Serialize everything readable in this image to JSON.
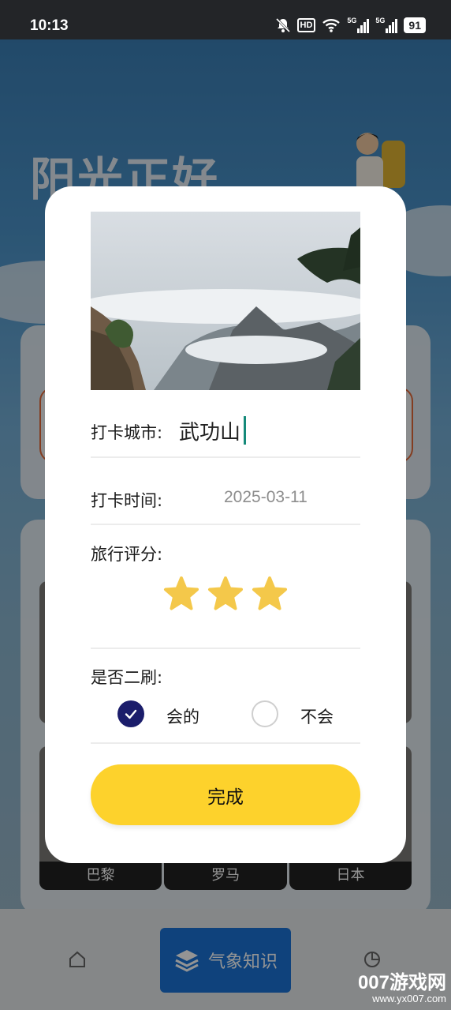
{
  "status_bar": {
    "time": "10:13",
    "hd": "HD",
    "net1": "5G",
    "net2": "5G",
    "battery": "91"
  },
  "background": {
    "hero_title": "阳光正好",
    "cards": [
      "巴黎",
      "罗马",
      "日本"
    ],
    "nav_center_label": "气象知识"
  },
  "dialog": {
    "city_label": "打卡城市:",
    "city_value": "武功山",
    "time_label": "打卡时间:",
    "time_value": "2025-03-11",
    "rating_label": "旅行评分:",
    "rating_stars": 3,
    "revisit_label": "是否二刷:",
    "option_yes": "会的",
    "option_no": "不会",
    "selected": "yes",
    "done_button": "完成"
  },
  "watermark": {
    "big": "007游戏网",
    "small": "www.yx007.com"
  },
  "colors": {
    "accent_button": "#fdd22c",
    "radio_selected": "#1b1d6b",
    "caret": "#158a7a",
    "nav_center": "#1a73d6",
    "star": "#f4c84a"
  }
}
